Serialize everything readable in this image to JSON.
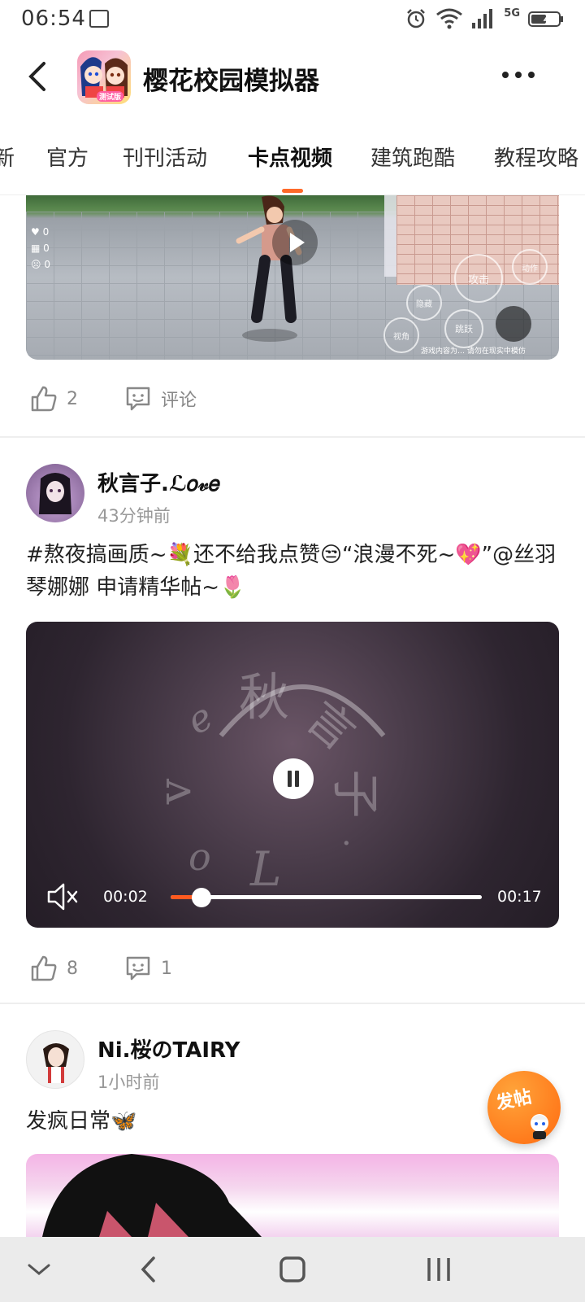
{
  "status_bar": {
    "time": "06:54",
    "network": "5G"
  },
  "header": {
    "title": "樱花校园模拟器",
    "app_icon_badge": "测试版"
  },
  "tabs": [
    {
      "label": "新"
    },
    {
      "label": "官方"
    },
    {
      "label": "刊刊活动"
    },
    {
      "label": "卡点视频",
      "active": true
    },
    {
      "label": "建筑跑酷"
    },
    {
      "label": "教程攻略"
    }
  ],
  "post1": {
    "video": {
      "hud": [
        "0",
        "0",
        "0"
      ],
      "controls": [
        "攻击",
        "动作",
        "视角",
        "跳跃",
        "隐藏"
      ],
      "footer_note": "游戏内容为… 请勿在现实中模仿"
    },
    "likes": "2",
    "comment_label": "评论"
  },
  "post2": {
    "author": "秋言子.ℒ𝑜𝓋𝑒",
    "time": "43分钟前",
    "text": "#熬夜搞画质~💐还不给我点赞😒“浪漫不死~💖”@丝羽琴娜娜  申请精华帖~🌷",
    "video": {
      "current_time": "00:02",
      "duration": "00:17",
      "progress": 0.1,
      "watermark": [
        "秋",
        "言",
        "子",
        "e",
        "v",
        "o",
        "L",
        "·"
      ]
    },
    "likes": "8",
    "comments": "1"
  },
  "post3": {
    "author": "Ni.桜のTAIRY",
    "time": "1小时前",
    "text": "发疯日常🦋"
  },
  "fab": {
    "label": "发帖"
  },
  "colors": {
    "accent": "#ff6a2a",
    "progress": "#ff5a1f",
    "nav_bg": "#ebebeb"
  }
}
